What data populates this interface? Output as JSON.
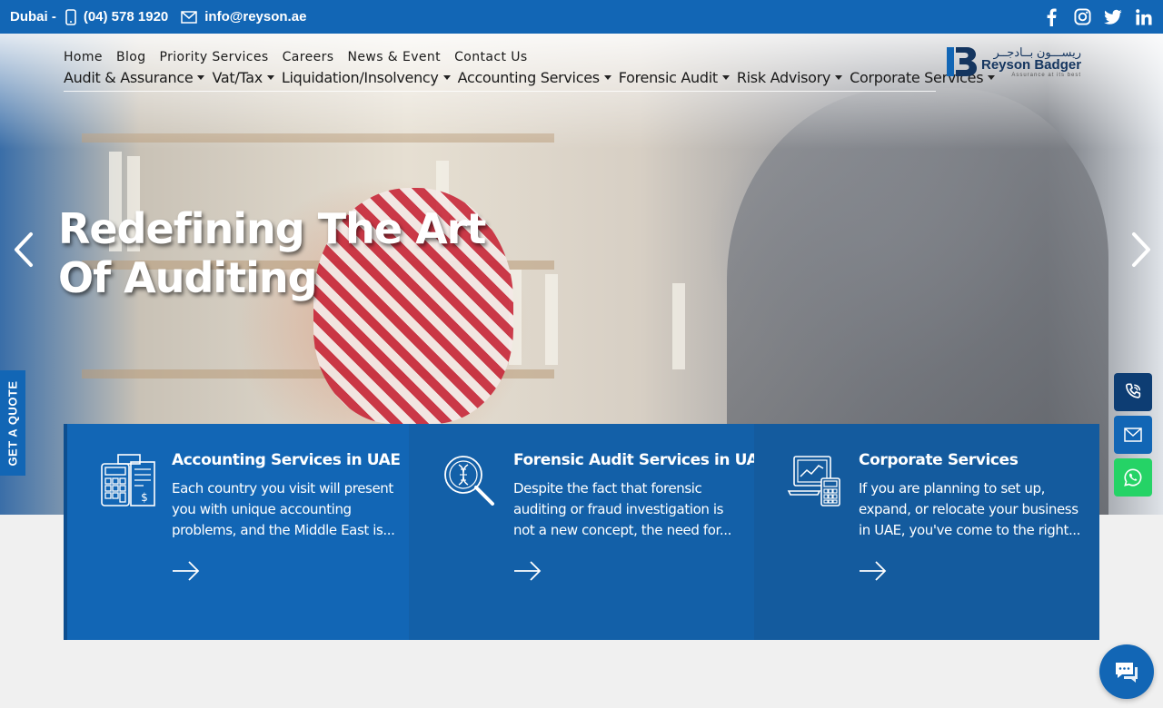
{
  "topbar": {
    "location": "Dubai -",
    "phone": "(04) 578 1920",
    "email": "info@reyson.ae",
    "social": [
      "facebook-icon",
      "instagram-icon",
      "twitter-icon",
      "linkedin-icon"
    ]
  },
  "nav": {
    "primary": [
      {
        "label": "Home"
      },
      {
        "label": "Blog"
      },
      {
        "label": "Priority Services"
      },
      {
        "label": "Careers"
      },
      {
        "label": "News & Event"
      },
      {
        "label": "Contact Us"
      }
    ],
    "secondary": [
      {
        "label": "Audit & Assurance"
      },
      {
        "label": "Vat/Tax"
      },
      {
        "label": "Liquidation/Insolvency"
      },
      {
        "label": "Accounting Services"
      },
      {
        "label": "Forensic Audit"
      },
      {
        "label": "Risk Advisory"
      },
      {
        "label": "Corporate Services"
      }
    ]
  },
  "logo": {
    "arabic": "ريســـون بــادجــر",
    "english": "Reyson Badger",
    "tagline": "Assurance at its best"
  },
  "hero": {
    "title_line1": "Redefining The Art",
    "title_line2": "Of Auditing"
  },
  "quote_tab": "GET A QUOTE",
  "cards": [
    {
      "title": "Accounting Services in UAE",
      "text": "Each country you visit will present you with unique accounting problems, and the Middle East is...",
      "bg": "#1266b5"
    },
    {
      "title": "Forensic Audit Services in UAE",
      "text": "Despite the fact that forensic auditing or fraud investigation is not a new concept, the need for...",
      "bg": "#1360a8"
    },
    {
      "title": "Corporate Services",
      "text": "If you are planning to set up, expand, or relocate your business in UAE, you've come to the right...",
      "bg": "#145b9e"
    }
  ],
  "colors": {
    "brand": "#1266b5",
    "call": "#0d3d73",
    "mail": "#1266b5",
    "whatsapp": "#25d366"
  }
}
